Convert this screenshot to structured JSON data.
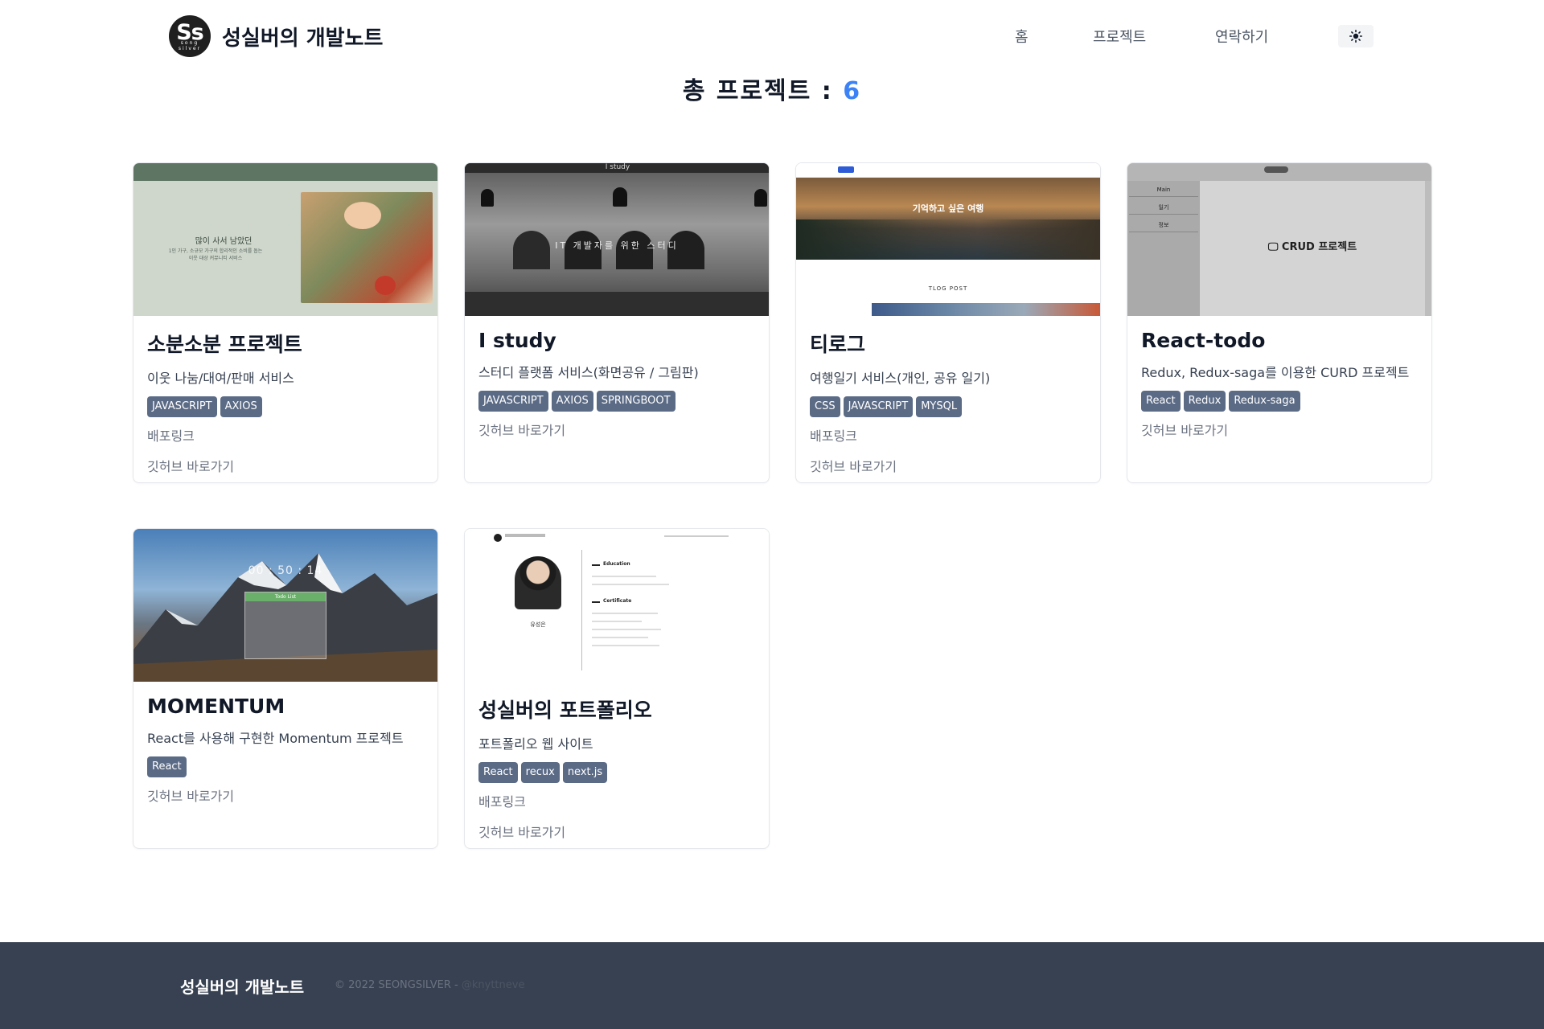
{
  "header": {
    "logo_mark": "Ss",
    "logo_mark_sub": "song silver",
    "title": "성실버의 개발노트",
    "nav": [
      {
        "label": "홈"
      },
      {
        "label": "프로젝트"
      },
      {
        "label": "연락하기"
      }
    ],
    "theme_icon": "sun-icon"
  },
  "page": {
    "title_label": "총 프로젝트 :",
    "total": "6"
  },
  "projects": [
    {
      "name": "소분소분 프로젝트",
      "desc": "이웃 나눔/대여/판매 서비스",
      "tags": [
        "JAVASCRIPT",
        "AXIOS"
      ],
      "links": [
        "배포링크",
        "깃허브 바로가기"
      ],
      "thumb": {
        "heading": "많이 사서 남았던",
        "line1": "1인 가구, 소규모 가구의 합리적인 소비를 돕는",
        "line2": "이웃 대상 커뮤니티 서비스"
      }
    },
    {
      "name": "I study",
      "desc": "스터디 플랫폼 서비스(화면공유 / 그림판)",
      "tags": [
        "JAVASCRIPT",
        "AXIOS",
        "SPRINGBOOT"
      ],
      "links": [
        "깃허브 바로가기"
      ],
      "thumb": {
        "heading": "IT 개발자를 위한 스터디",
        "brand": "I study"
      }
    },
    {
      "name": "티로그",
      "desc": "여행일기 서비스(개인, 공유 일기)",
      "tags": [
        "CSS",
        "JAVASCRIPT",
        "MYSQL"
      ],
      "links": [
        "배포링크",
        "깃허브 바로가기"
      ],
      "thumb": {
        "heading": "기억하고 싶은 여행",
        "section": "TLOG POST"
      }
    },
    {
      "name": "React-todo",
      "desc": "Redux, Redux-saga를 이용한 CURD 프로젝트",
      "tags": [
        "React",
        "Redux",
        "Redux-saga"
      ],
      "links": [
        "깃허브 바로가기"
      ],
      "thumb": {
        "heading": "CRUD 프로젝트",
        "menu": [
          "Main",
          "일기",
          "정보"
        ]
      }
    },
    {
      "name": "MOMENTUM",
      "desc": "React를 사용해 구현한 Momentum 프로젝트",
      "tags": [
        "React"
      ],
      "links": [
        "깃허브 바로가기"
      ],
      "thumb": {
        "clock": "00 : 50 : 14",
        "panel": "Todo List"
      }
    },
    {
      "name": "성실버의 포트폴리오",
      "desc": "포트폴리오 웹 사이트",
      "tags": [
        "React",
        "recux",
        "next.js"
      ],
      "links": [
        "배포링크",
        "깃허브 바로가기"
      ],
      "thumb": {
        "name": "유성은",
        "sections": [
          "Education",
          "Certificate"
        ]
      }
    }
  ],
  "footer": {
    "title": "성실버의 개발노트",
    "copyright": "© 2022 SEONGSILVER -",
    "handle": "@knyttneve"
  },
  "colors": {
    "accent": "#3b82f6",
    "tag_bg": "#5b6b86",
    "footer_bg": "#374151"
  }
}
